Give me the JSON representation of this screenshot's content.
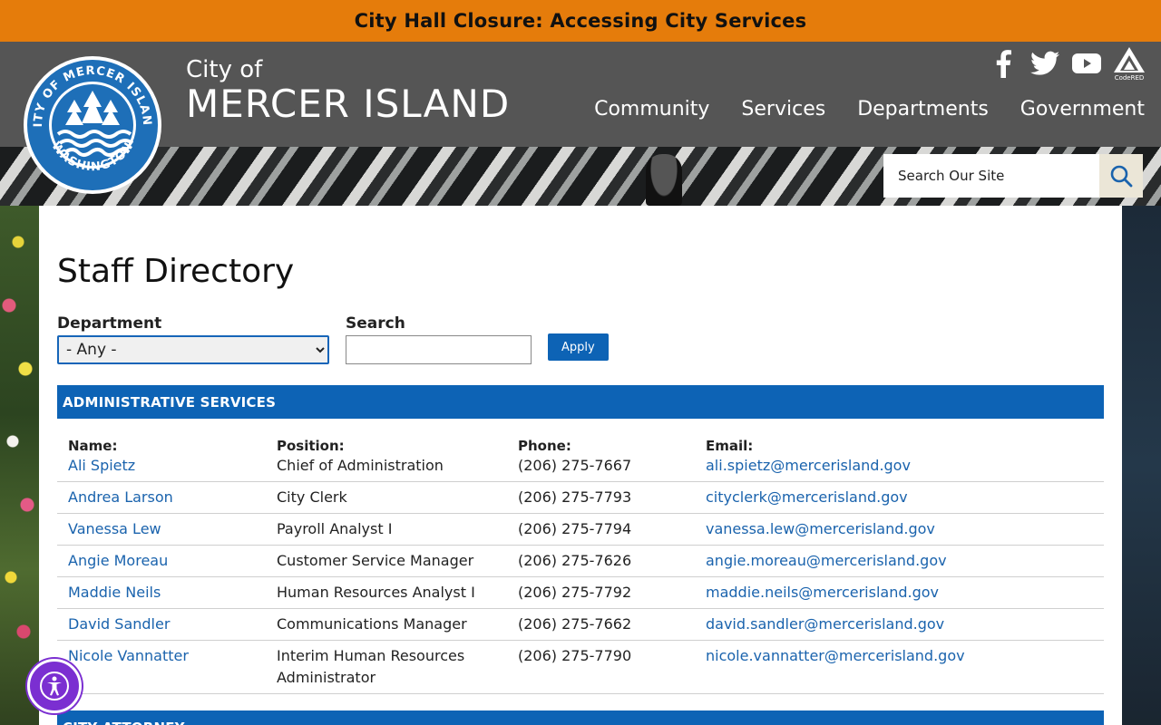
{
  "alert": {
    "text": "City Hall Closure: Accessing City Services"
  },
  "brand": {
    "line1": "City of",
    "line2": "MERCER ISLAND",
    "seal_text_top": "CITY OF MERCER ISLAND",
    "seal_text_bottom": "WASHINGTON"
  },
  "social": {
    "codered_label": "CodeRED"
  },
  "nav": [
    "Community",
    "Services",
    "Departments",
    "Government"
  ],
  "site_search": {
    "placeholder": "Search Our Site"
  },
  "page": {
    "title": "Staff Directory"
  },
  "filters": {
    "department_label": "Department",
    "department_value": "- Any -",
    "search_label": "Search",
    "search_value": "",
    "apply_label": "Apply"
  },
  "sections": [
    {
      "title": "ADMINISTRATIVE SERVICES",
      "headers": {
        "name": "Name:",
        "position": "Position:",
        "phone": "Phone:",
        "email": "Email:"
      },
      "rows": [
        {
          "name": "Ali Spietz",
          "position": "Chief of Administration",
          "phone": "(206) 275-7667",
          "email": "ali.spietz@mercerisland.gov"
        },
        {
          "name": "Andrea Larson",
          "position": "City Clerk",
          "phone": "(206) 275-7793",
          "email": "cityclerk@mercerisland.gov"
        },
        {
          "name": "Vanessa Lew",
          "position": "Payroll Analyst I",
          "phone": "(206) 275-7794",
          "email": "vanessa.lew@mercerisland.gov"
        },
        {
          "name": "Angie Moreau",
          "position": "Customer Service Manager",
          "phone": "(206) 275-7626",
          "email": "angie.moreau@mercerisland.gov"
        },
        {
          "name": "Maddie Neils",
          "position": "Human Resources Analyst I",
          "phone": "(206) 275-7792",
          "email": "maddie.neils@mercerisland.gov"
        },
        {
          "name": "David Sandler",
          "position": "Communications Manager",
          "phone": "(206) 275-7662",
          "email": "david.sandler@mercerisland.gov"
        },
        {
          "name": "Nicole Vannatter",
          "position": "Interim Human Resources Administrator",
          "phone": "(206) 275-7790",
          "email": "nicole.vannatter@mercerisland.gov"
        }
      ]
    },
    {
      "title": "CITY ATTORNEY"
    }
  ],
  "colors": {
    "alert": "#e57c0b",
    "header": "#555555",
    "accent": "#0d63b5",
    "link": "#1a63ad",
    "a11y": "#7b2fd1"
  }
}
